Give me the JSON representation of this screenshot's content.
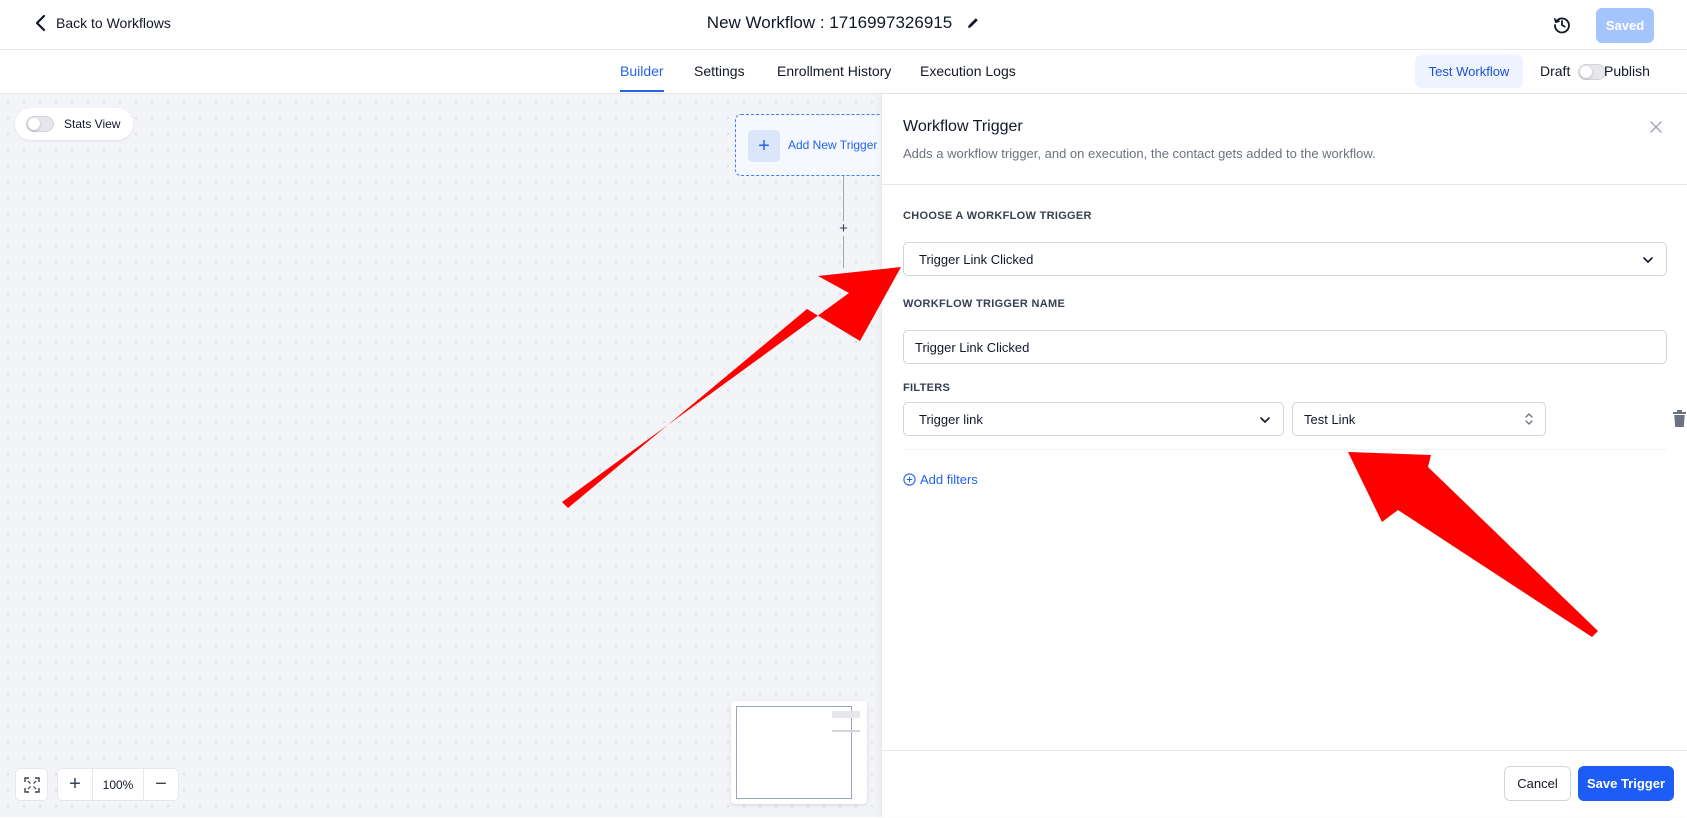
{
  "header": {
    "back_label": "Back to Workflows",
    "title": "New Workflow : 1716997326915",
    "saved_label": "Saved"
  },
  "tabs": [
    {
      "label": "Builder",
      "active": true
    },
    {
      "label": "Settings",
      "active": false
    },
    {
      "label": "Enrollment History",
      "active": false
    },
    {
      "label": "Execution Logs",
      "active": false
    }
  ],
  "actions": {
    "test_workflow_label": "Test Workflow",
    "draft_label": "Draft",
    "publish_label": "Publish",
    "publish_enabled": false
  },
  "canvas": {
    "stats_view_label": "Stats View",
    "stats_view_enabled": false,
    "add_trigger_label": "Add New Trigger",
    "zoom_level": "100%"
  },
  "panel": {
    "title": "Workflow Trigger",
    "description": "Adds a workflow trigger, and on execution, the contact gets added to the workflow.",
    "choose_trigger_label": "CHOOSE A WORKFLOW TRIGGER",
    "selected_trigger": "Trigger Link Clicked",
    "trigger_name_label": "WORKFLOW TRIGGER NAME",
    "trigger_name_value": "Trigger Link Clicked",
    "filters_label": "FILTERS",
    "filters": [
      {
        "field": "Trigger link",
        "value": "Test Link"
      }
    ],
    "add_filters_label": "Add filters",
    "cancel_label": "Cancel",
    "save_label": "Save Trigger"
  },
  "colors": {
    "accent": "#2563eb",
    "primary_button": "#1d5cf5",
    "saved_button": "#a3c4fd",
    "annotation_arrow": "#ff0000"
  },
  "icons": [
    "chevron-left-icon",
    "edit-pencil-icon",
    "history-clock-icon",
    "plus-icon",
    "fit-view-icon",
    "minus-icon",
    "close-icon",
    "chevron-down-icon",
    "sort-updown-icon",
    "trash-icon",
    "plus-circle-icon"
  ]
}
